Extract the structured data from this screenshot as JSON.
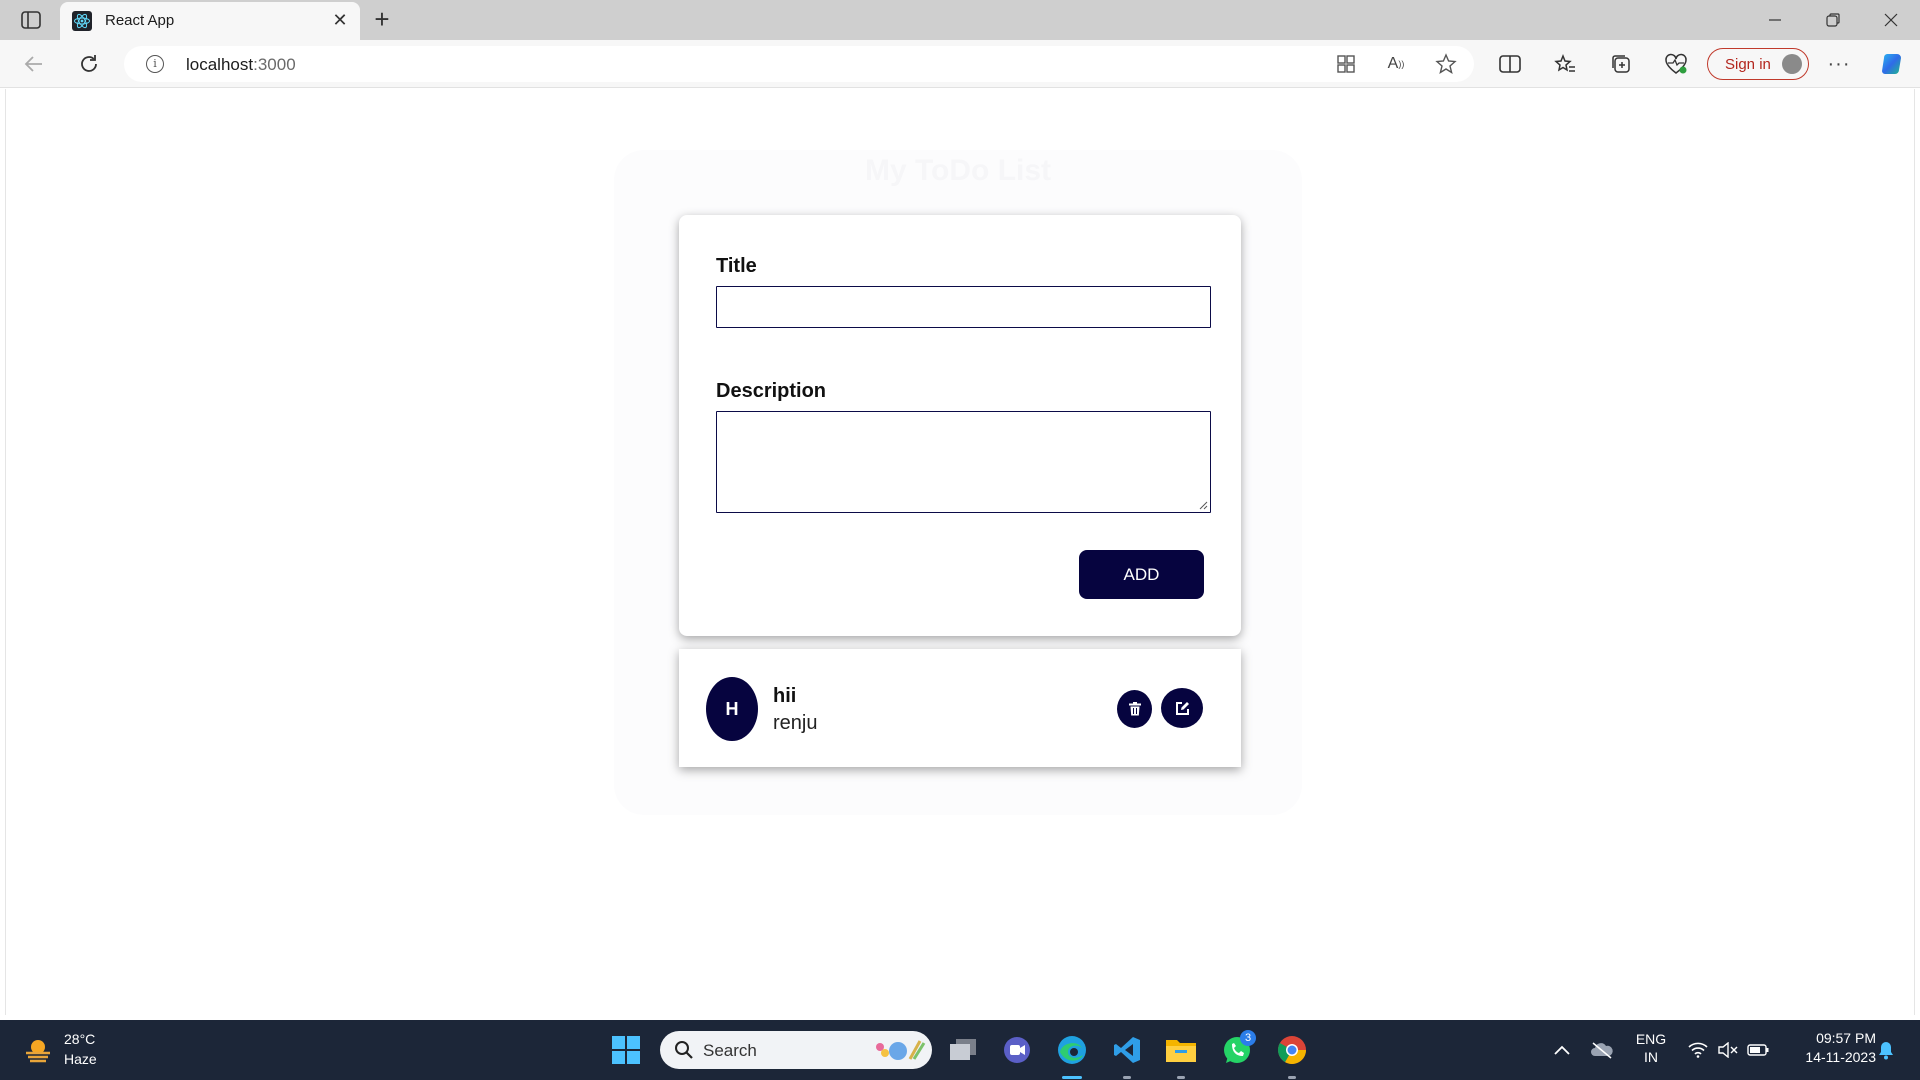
{
  "browser": {
    "tab_title": "React App",
    "url_host": "localhost",
    "url_port": ":3000",
    "signin_label": "Sign in"
  },
  "page": {
    "heading": "My ToDo List",
    "form": {
      "title_label": "Title",
      "title_value": "",
      "description_label": "Description",
      "description_value": "",
      "add_label": "ADD"
    },
    "todos": [
      {
        "avatar_letter": "H",
        "title": "hii",
        "description": "renju"
      }
    ]
  },
  "taskbar": {
    "weather_temp": "28°C",
    "weather_condition": "Haze",
    "search_label": "Search",
    "whatsapp_badge": "3",
    "lang_top": "ENG",
    "lang_bottom": "IN",
    "time": "09:57 PM",
    "date": "14-11-2023"
  },
  "colors": {
    "accent": "#06043f",
    "input_border": "#0b0b48",
    "taskbar_bg": "#1c2638",
    "signin_border": "#c0392b"
  },
  "icons": [
    "tab-actions-icon",
    "react-favicon",
    "close-icon",
    "plus-icon",
    "minimize-icon",
    "restore-icon",
    "back-icon",
    "refresh-icon",
    "info-icon",
    "apps-icon",
    "read-aloud-icon",
    "star-icon",
    "split-screen-icon",
    "favorites-icon",
    "collections-icon",
    "performance-icon",
    "more-icon",
    "copilot-icon",
    "trash-icon",
    "edit-icon",
    "windows-icon",
    "search-icon",
    "task-view-icon",
    "teams-icon",
    "edge-icon",
    "vscode-icon",
    "file-explorer-icon",
    "whatsapp-icon",
    "chrome-icon",
    "chevron-up-icon",
    "onedrive-icon",
    "wifi-icon",
    "volume-muted-icon",
    "battery-icon",
    "bell-icon"
  ]
}
